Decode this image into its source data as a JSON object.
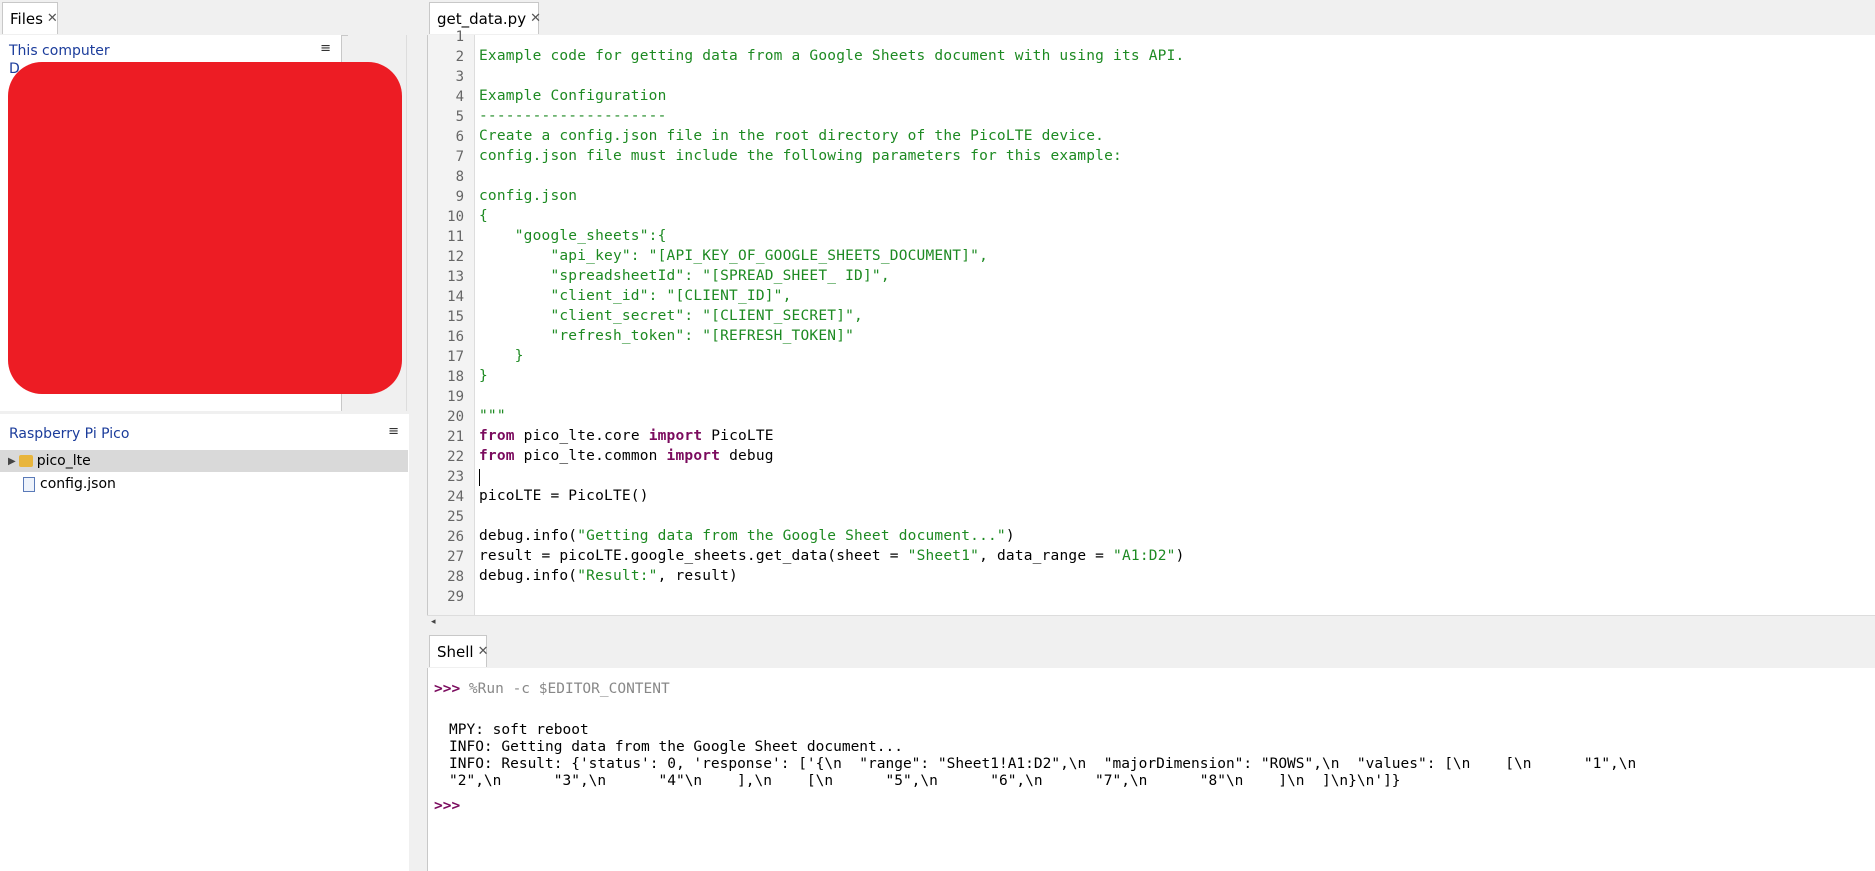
{
  "files_tab": {
    "label": "Files",
    "close": "✕"
  },
  "local": {
    "title": "This computer",
    "hint": "D",
    "menu": "≡"
  },
  "pico": {
    "title": "Raspberry Pi Pico",
    "menu": "≡",
    "items": [
      {
        "label": "pico_lte",
        "type": "folder"
      },
      {
        "label": "config.json",
        "type": "file"
      }
    ]
  },
  "editor_tab": {
    "label": "get_data.py",
    "close": "✕"
  },
  "editor": {
    "line_numbers": [
      "1",
      "2",
      "3",
      "4",
      "5",
      "6",
      "7",
      "8",
      "9",
      "10",
      "11",
      "12",
      "13",
      "14",
      "15",
      "16",
      "17",
      "18",
      "19",
      "20",
      "21",
      "22",
      "23",
      "24",
      "25",
      "26",
      "27",
      "28",
      "29"
    ],
    "lines": {
      "l2": "Example code for getting data from a Google Sheets document with using its API.",
      "l4": "Example Configuration",
      "l5": "---------------------",
      "l6": "Create a config.json file in the root directory of the PicoLTE device.",
      "l7": "config.json file must include the following parameters for this example:",
      "l9": "config.json",
      "l10": "{",
      "l11": "    \"google_sheets\":{",
      "l12": "        \"api_key\": \"[API_KEY_OF_GOOGLE_SHEETS_DOCUMENT]\",",
      "l13": "        \"spreadsheetId\": \"[SPREAD_SHEET_ ID]\",",
      "l14": "        \"client_id\": \"[CLIENT_ID]\",",
      "l15": "        \"client_secret\": \"[CLIENT_SECRET]\",",
      "l16": "        \"refresh_token\": \"[REFRESH_TOKEN]\"",
      "l17": "    }",
      "l18": "}",
      "l20": "\"\"\"",
      "l21_kw1": "from",
      "l21_mod": " pico_lte.core ",
      "l21_kw2": "import",
      "l21_name": " PicoLTE",
      "l22_kw1": "from",
      "l22_mod": " pico_lte.common ",
      "l22_kw2": "import",
      "l22_name": " debug",
      "l24": "picoLTE = PicoLTE()",
      "l26_a": "debug.info(",
      "l26_s": "\"Getting data from the Google Sheet document...\"",
      "l26_b": ")",
      "l27_a": "result = picoLTE.google_sheets.get_data(sheet = ",
      "l27_s1": "\"Sheet1\"",
      "l27_b": ", data_range = ",
      "l27_s2": "\"A1:D2\"",
      "l27_c": ")",
      "l28_a": "debug.info(",
      "l28_s": "\"Result:\"",
      "l28_b": ", result)"
    }
  },
  "shell_tab": {
    "label": "Shell",
    "close": "✕"
  },
  "shell": {
    "prompt": ">>>",
    "command": " %Run -c $EDITOR_CONTENT",
    "out1": "MPY: soft reboot",
    "out2": "INFO: Getting data from the Google Sheet document...",
    "out3": "INFO: Result: {'status': 0, 'response': ['{\\n  \"range\": \"Sheet1!A1:D2\",\\n  \"majorDimension\": \"ROWS\",\\n  \"values\": [\\n    [\\n      \"1\",\\n",
    "out4": "\"2\",\\n      \"3\",\\n      \"4\"\\n    ],\\n    [\\n      \"5\",\\n      \"6\",\\n      \"7\",\\n      \"8\"\\n    ]\\n  ]\\n}\\n']}"
  }
}
